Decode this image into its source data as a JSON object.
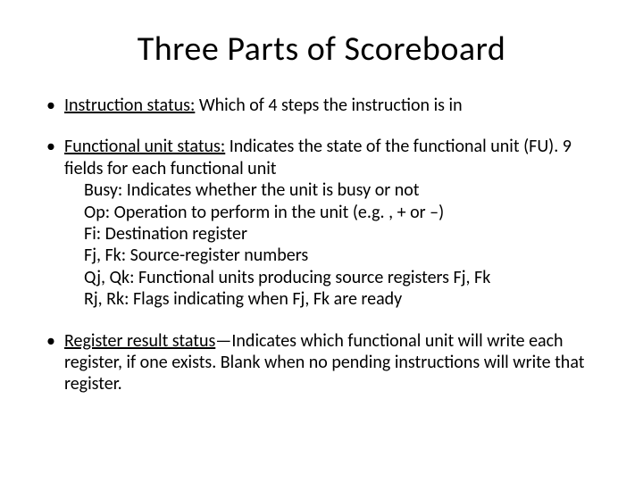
{
  "title": "Three Parts of Scoreboard",
  "b1": {
    "label": "Instruction status:",
    "rest": " Which of 4 steps the instruction is in"
  },
  "b2": {
    "label": "Functional unit status:",
    "rest": " Indicates the state of the functional unit (FU). 9 fields for each functional unit",
    "fields": {
      "busy": {
        "name": "Busy:",
        "desc": " Indicates whether the unit is busy or not"
      },
      "op": {
        "name": "Op:",
        "desc": " Operation to perform in the unit (e.g. , + or –)"
      },
      "fi": {
        "name": "Fi:",
        "desc": " Destination register"
      },
      "fjfk": {
        "name": "Fj, Fk:",
        "desc": " Source-register numbers"
      },
      "qjqk": {
        "name": "Qj, Qk:",
        "desc": " Functional units producing source registers Fj, Fk"
      },
      "rjrk": {
        "name": "Rj, Rk:",
        "desc": " Flags indicating when Fj, Fk are ready"
      }
    }
  },
  "b3": {
    "label": "Register result status",
    "rest": "—Indicates which functional unit will write each register, if one exists. Blank when no pending instructions will write that register."
  }
}
